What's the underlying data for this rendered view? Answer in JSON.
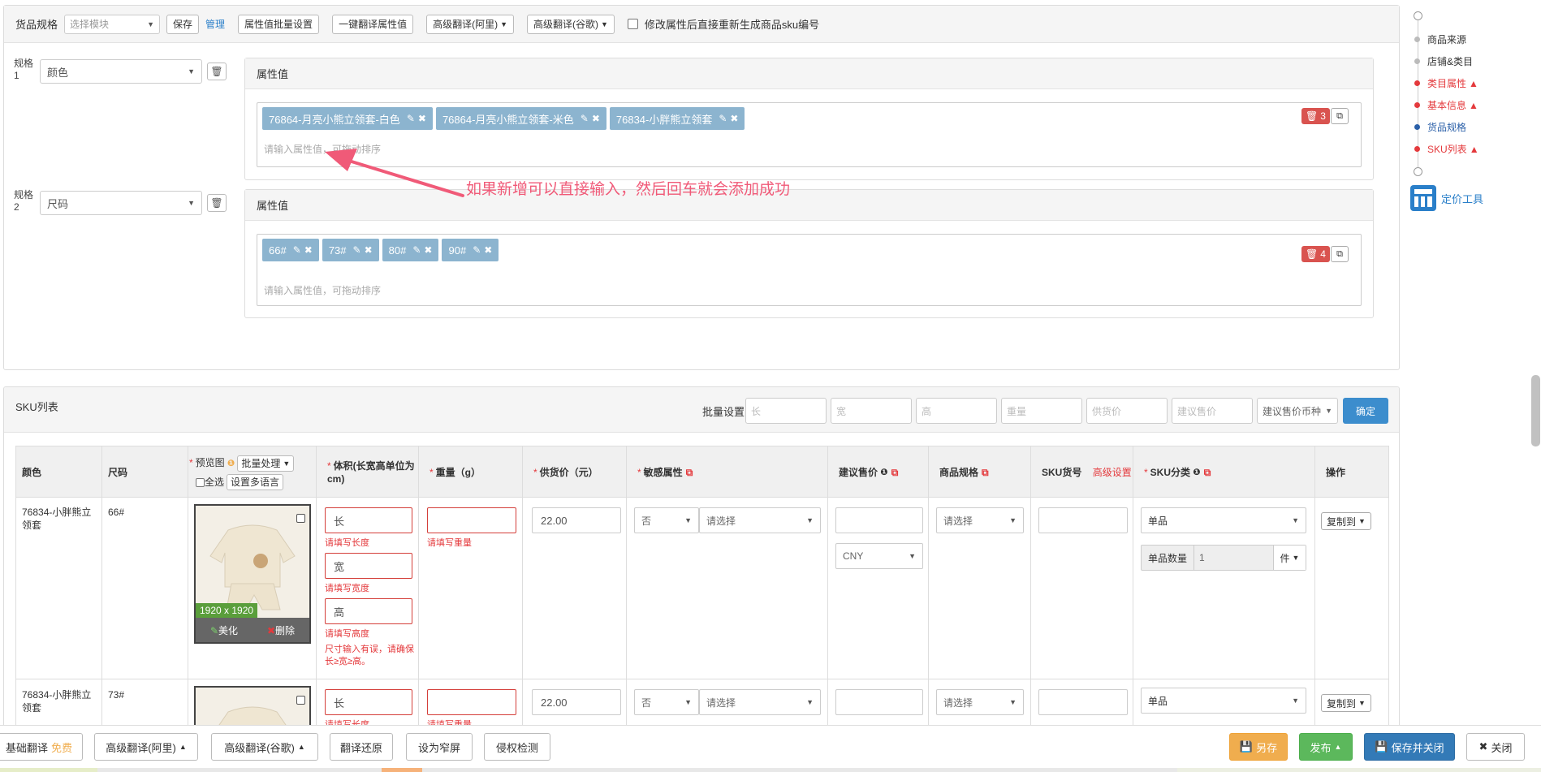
{
  "toolbar": {
    "label": "货品规格",
    "template_placeholder": "选择模块",
    "save": "保存",
    "manage": "管理",
    "batch_attr": "属性值批量设置",
    "one_click_translate": "一键翻译属性值",
    "adv_translate_ali": "高级翻译(阿里)",
    "adv_translate_google": "高级翻译(谷歌)",
    "regen_sku_label": "修改属性后直接重新生成商品sku编号"
  },
  "specs": [
    {
      "label": "规格1",
      "value": "颜色",
      "header": "属性值",
      "tags": [
        "76864-月亮小熊立领套-白色",
        "76864-月亮小熊立领套-米色",
        "76834-小胖熊立领套"
      ],
      "count": "3",
      "placeholder": "请输入属性值，可拖动排序"
    },
    {
      "label": "规格2",
      "value": "尺码",
      "header": "属性值",
      "tags": [
        "66#",
        "73#",
        "80#",
        "90#"
      ],
      "count": "4",
      "placeholder": "请输入属性值，可拖动排序"
    }
  ],
  "annotation": "如果新增可以直接输入，然后回车就会添加成功",
  "sku": {
    "title": "SKU列表",
    "batch_label": "批量设置",
    "batch_placeholders": [
      "长",
      "宽",
      "高",
      "重量",
      "供货价",
      "建议售价",
      "建议售价币种"
    ],
    "confirm": "确定",
    "headers": {
      "color": "颜色",
      "size": "尺码",
      "preview": "预览图",
      "batch_process": "批量处理",
      "select_all": "全选",
      "multi_lang": "设置多语言",
      "volume": "体积(长宽高单位为cm)",
      "weight": "重量（g）",
      "supply_price": "供货价（元）",
      "sensitive": "敏感属性",
      "suggest_price": "建议售价",
      "spec": "商品规格",
      "sku_no": "SKU货号",
      "advanced": "高级设置",
      "sku_category": "SKU分类",
      "action": "操作"
    },
    "rows": [
      {
        "color": "76834-小胖熊立领套",
        "size": "66#",
        "img_size": "1920 x 1920",
        "beautify": "美化",
        "delete": "删除",
        "len_ph": "长",
        "wid_ph": "宽",
        "hei_ph": "高",
        "len_err": "请填写长度",
        "wid_err": "请填写宽度",
        "hei_err": "请填写高度",
        "size_err": "尺寸输入有误，请确保长≥宽≥高。",
        "weight_err": "请填写重量",
        "price": "22.00",
        "sensitive_val": "否",
        "sensitive_ph": "请选择",
        "currency": "CNY",
        "spec_ph": "请选择",
        "category": "单品",
        "qty_label": "单品数量",
        "qty": "1",
        "unit": "件",
        "copy_to": "复制到"
      },
      {
        "color": "76834-小胖熊立领套",
        "size": "73#",
        "len_ph": "长",
        "len_err": "请填写长度",
        "weight_err": "请填写重量",
        "price": "22.00",
        "sensitive_val": "否",
        "sensitive_ph": "请选择",
        "spec_ph": "请选择",
        "category": "单品",
        "copy_to": "复制到"
      }
    ]
  },
  "rnav": {
    "items": [
      {
        "label": "商品来源",
        "color": "#bbbbbb",
        "warn": false
      },
      {
        "label": "店铺&类目",
        "color": "#bbbbbb",
        "warn": false
      },
      {
        "label": "类目属性",
        "color": "#e4393c",
        "warn": true
      },
      {
        "label": "基本信息",
        "color": "#e4393c",
        "warn": true
      },
      {
        "label": "货品规格",
        "color": "#2a5fa8",
        "warn": false
      },
      {
        "label": "SKU列表",
        "color": "#e4393c",
        "warn": true
      }
    ],
    "tool": "定价工具"
  },
  "footer": {
    "basic_translate": "基础翻译",
    "free": "免费",
    "adv_ali": "高级翻译(阿里)",
    "adv_google": "高级翻译(谷歌)",
    "restore": "翻译还原",
    "narrow": "设为窄屏",
    "infringe": "侵权检测",
    "save_as": "另存",
    "publish": "发布",
    "save_close": "保存并关闭",
    "close": "关闭"
  }
}
